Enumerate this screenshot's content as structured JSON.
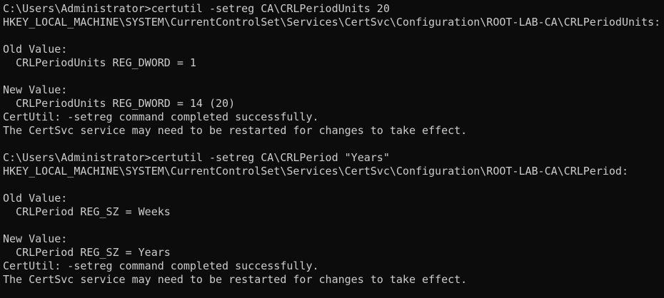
{
  "terminal": {
    "lines": [
      "C:\\Users\\Administrator>certutil -setreg CA\\CRLPeriodUnits 20",
      "HKEY_LOCAL_MACHINE\\SYSTEM\\CurrentControlSet\\Services\\CertSvc\\Configuration\\ROOT-LAB-CA\\CRLPeriodUnits:",
      "",
      "Old Value:",
      "  CRLPeriodUnits REG_DWORD = 1",
      "",
      "New Value:",
      "  CRLPeriodUnits REG_DWORD = 14 (20)",
      "CertUtil: -setreg command completed successfully.",
      "The CertSvc service may need to be restarted for changes to take effect.",
      "",
      "C:\\Users\\Administrator>certutil -setreg CA\\CRLPeriod \"Years\"",
      "HKEY_LOCAL_MACHINE\\SYSTEM\\CurrentControlSet\\Services\\CertSvc\\Configuration\\ROOT-LAB-CA\\CRLPeriod:",
      "",
      "Old Value:",
      "  CRLPeriod REG_SZ = Weeks",
      "",
      "New Value:",
      "  CRLPeriod REG_SZ = Years",
      "CertUtil: -setreg command completed successfully.",
      "The CertSvc service may need to be restarted for changes to take effect."
    ]
  }
}
